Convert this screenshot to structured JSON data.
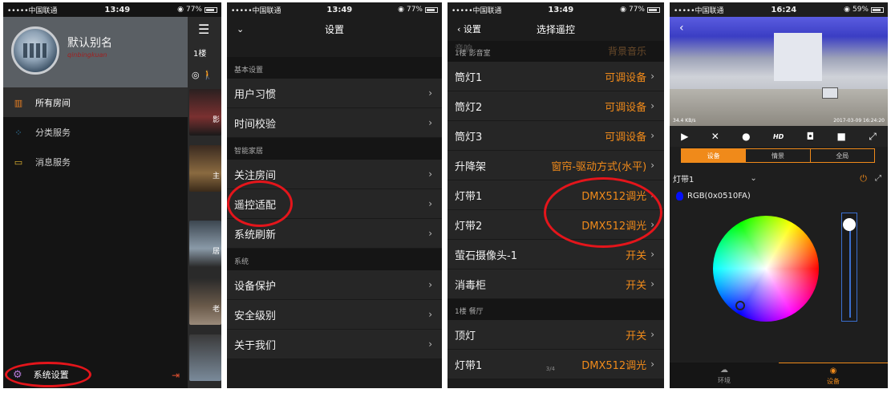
{
  "status": {
    "carrier": "•••••中国联通",
    "time": "13:49",
    "battery": "77%"
  },
  "status4": {
    "carrier": "•••••中国联通",
    "time": "16:24",
    "battery": "59%"
  },
  "p1": {
    "profile_name": "默认别名",
    "profile_id": "qinbingkuan",
    "floor": "1楼",
    "menu": [
      {
        "label": "所有房间",
        "icon": "building-icon"
      },
      {
        "label": "分类服务",
        "icon": "grid-icon"
      },
      {
        "label": "消息服务",
        "icon": "message-icon"
      }
    ],
    "thumbs": [
      "影",
      "主",
      "居",
      "老"
    ],
    "bottom_label": "系统设置"
  },
  "p2": {
    "title": "设置",
    "sections": [
      {
        "header": "基本设置",
        "items": [
          "用户习惯",
          "时间校验"
        ]
      },
      {
        "header": "智能家居",
        "items": [
          "关注房间",
          "遥控适配",
          "系统刷新"
        ]
      },
      {
        "header": "系统",
        "items": [
          "设备保护",
          "安全级别",
          "关于我们"
        ]
      }
    ]
  },
  "p3": {
    "back": "设置",
    "title": "选择遥控",
    "ghost_left": "音响",
    "ghost_right": "背景音乐",
    "section1": "1楼 影音室",
    "rows": [
      {
        "name": "筒灯1",
        "value": "可调设备"
      },
      {
        "name": "筒灯2",
        "value": "可调设备"
      },
      {
        "name": "筒灯3",
        "value": "可调设备"
      },
      {
        "name": "升降架",
        "value": "窗帘-驱动方式(水平)"
      },
      {
        "name": "灯带1",
        "value": "DMX512调光"
      },
      {
        "name": "灯带2",
        "value": "DMX512调光"
      },
      {
        "name": "萤石摄像头-1",
        "value": "开关"
      },
      {
        "name": "消毒柜",
        "value": "开关"
      }
    ],
    "section2": "1楼 餐厅",
    "rows2": [
      {
        "name": "顶灯",
        "value": "开关"
      },
      {
        "name": "灯带1",
        "value": "DMX512调光"
      }
    ],
    "pager": "3/4"
  },
  "p4": {
    "speed": "34.4 KB/s",
    "stamp": "2017-03-09 16:24:20",
    "tabs": [
      "设备",
      "情景",
      "全局"
    ],
    "device": "灯带1",
    "rgb": "RGB(0x0510FA)",
    "rgb_color": "#0510FA",
    "brightness": 0.95,
    "bottom_tabs": [
      "环境",
      "设备"
    ]
  }
}
